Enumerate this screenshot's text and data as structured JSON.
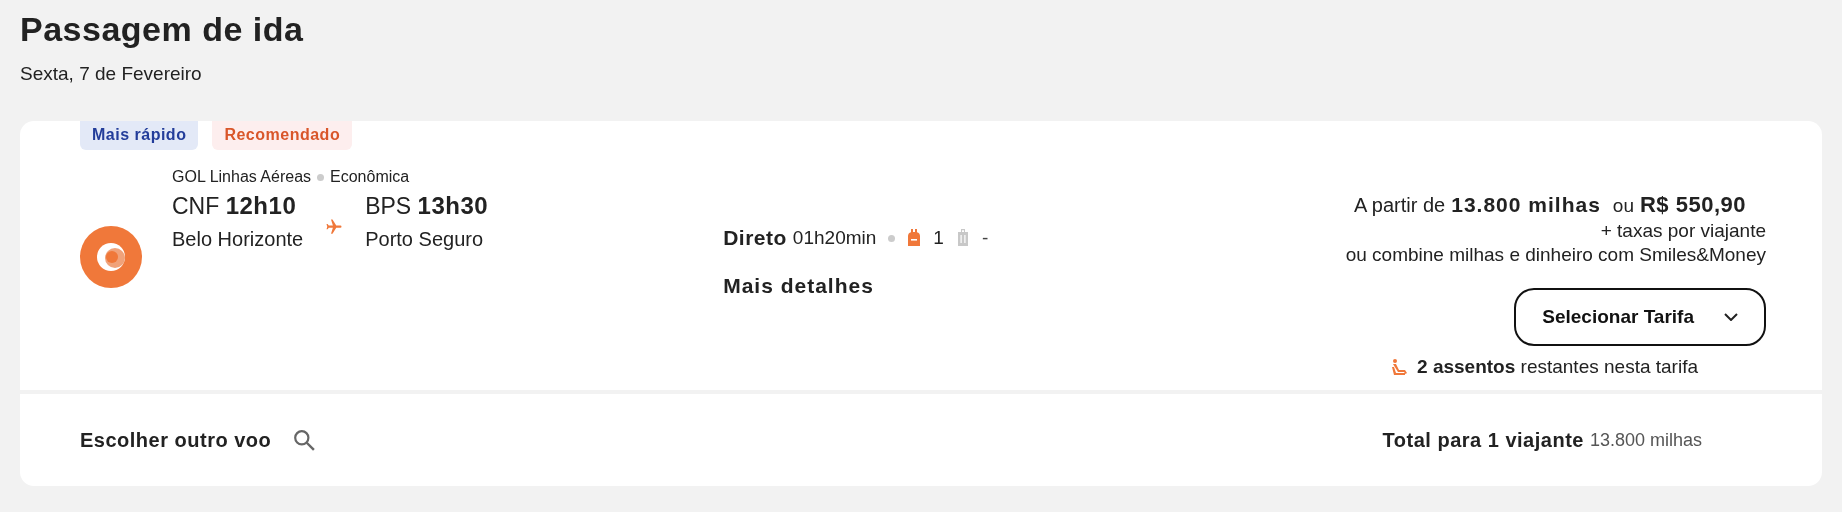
{
  "header": {
    "title": "Passagem de ida",
    "date": "Sexta, 7 de Fevereiro"
  },
  "badges": [
    {
      "label": "Mais rápido",
      "kind": "speed"
    },
    {
      "label": "Recomendado",
      "kind": "recommended"
    }
  ],
  "flight": {
    "airline": "GOL Linhas Aéreas",
    "cabin": "Econômica",
    "origin": {
      "code": "CNF",
      "time": "12h10",
      "city": "Belo Horizonte"
    },
    "destination": {
      "code": "BPS",
      "time": "13h30",
      "city": "Porto Seguro"
    },
    "stops": "Direto",
    "duration": "01h20min",
    "baggage": [
      {
        "kind": "carry-on",
        "included": true,
        "count": "1"
      },
      {
        "kind": "checked",
        "included": false,
        "count": "-"
      }
    ],
    "details_link": "Mais detalhes"
  },
  "price": {
    "prefix": "A partir de",
    "miles": "13.800 milhas",
    "or": "ou",
    "money": "R$ 550,90",
    "taxes": "+ taxas por viajante",
    "combine": "ou combine milhas e dinheiro com Smiles&Money",
    "button": "Selecionar Tarifa",
    "seats": "**2 assentos** restantes nesta tarifa"
  },
  "footer": {
    "search_link": "Escolher outro voo",
    "total_label": "Total para 1 viajante",
    "total_value": "13.800 milhas"
  }
}
